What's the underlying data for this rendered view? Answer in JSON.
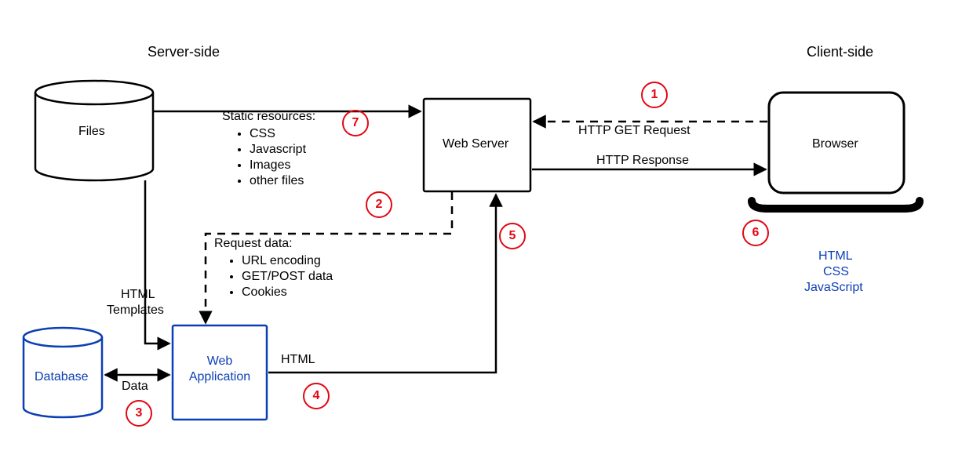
{
  "headings": {
    "server_side": "Server-side",
    "client_side": "Client-side"
  },
  "nodes": {
    "files": "Files",
    "web_server": "Web Server",
    "browser": "Browser",
    "web_application_l1": "Web",
    "web_application_l2": "Application",
    "database": "Database"
  },
  "static_res": {
    "title": "Static resources:",
    "items": [
      "CSS",
      "Javascript",
      "Images",
      "other files"
    ]
  },
  "request_data": {
    "title": "Request data:",
    "items": [
      "URL encoding",
      "GET/POST data",
      "Cookies"
    ]
  },
  "edge_labels": {
    "http_get": "HTTP GET Request",
    "http_response": "HTTP Response",
    "html_templates_l1": "HTML",
    "html_templates_l2": "Templates",
    "data": "Data",
    "html": "HTML"
  },
  "client_tech": {
    "l1": "HTML",
    "l2": "CSS",
    "l3": "JavaScript"
  },
  "badges": {
    "b1": "1",
    "b2": "2",
    "b3": "3",
    "b4": "4",
    "b5": "5",
    "b6": "6",
    "b7": "7"
  }
}
